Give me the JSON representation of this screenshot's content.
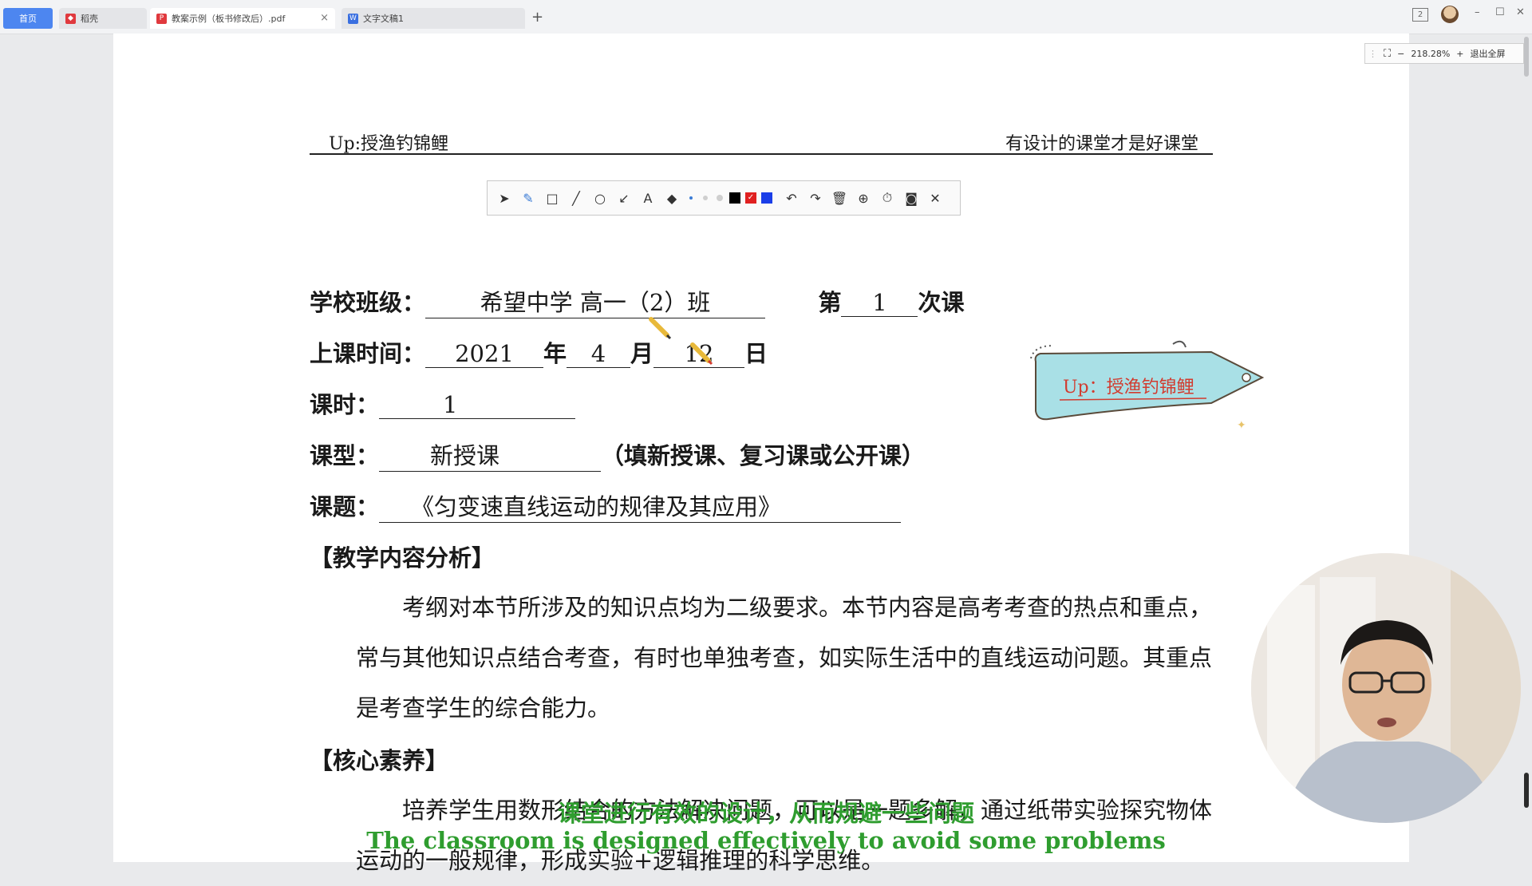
{
  "tabs": {
    "home": "首页",
    "items": [
      {
        "label": "稻壳",
        "icon": "docer-icon"
      },
      {
        "label": "教案示例（板书修改后）.pdf",
        "icon": "pdf-icon",
        "close": "×"
      },
      {
        "label": "文字文稿1",
        "icon": "writer-icon"
      }
    ],
    "add": "+"
  },
  "window": {
    "badge": "2",
    "minimize": "–",
    "maximize": "☐",
    "close": "✕"
  },
  "zoom": {
    "minus": "−",
    "value": "218.28%",
    "plus": "+",
    "exit": "退出全屏"
  },
  "doc": {
    "header_left": "Up:授渔钓锦鲤",
    "header_right": "有设计的课堂才是好课堂",
    "school_label": "学校班级：",
    "school_value": "希望中学  高一（2）班",
    "nth_pre": "第",
    "nth_value": "1",
    "nth_post": "次课",
    "time_label": "上课时间：",
    "year_value": "2021",
    "year_unit": "年",
    "month_value": "4",
    "month_unit": "月",
    "day_value": "12",
    "day_unit": "日",
    "hours_label": "课时：",
    "hours_value": "1",
    "type_label": "课型：",
    "type_value": "新授课",
    "type_hint": "（填新授课、复习课或公开课）",
    "topic_label": "课题：",
    "topic_value": "《匀变速直线运动的规律及其应用》",
    "section1": "【教学内容分析】",
    "para1": "考纲对本节所涉及的知识点均为二级要求。本节内容是高考考查的热点和重点，常与其他知识点结合考查，有时也单独考查，如实际生活中的直线运动问题。其重点是考查学生的综合能力。",
    "section2": "【核心素养】",
    "para2": "培养学生用数形结合的方法解决问题，可以是一题多解，通过纸带实验探究物体运动的一般规律，形成实验+逻辑推理的科学思维。"
  },
  "sticker": {
    "text": "Up：授渔钓锦鲤"
  },
  "subtitles": {
    "cn": "课堂进行有效的设计，从而规避一些问题",
    "en": "The classroom is designed effectively to avoid some problems"
  },
  "colors": {
    "tab_active": "#4d86f0",
    "subtitle": "#2f9d2f",
    "sticker_text": "#d23b2f",
    "sticker_fill": "#a9e0e6"
  }
}
